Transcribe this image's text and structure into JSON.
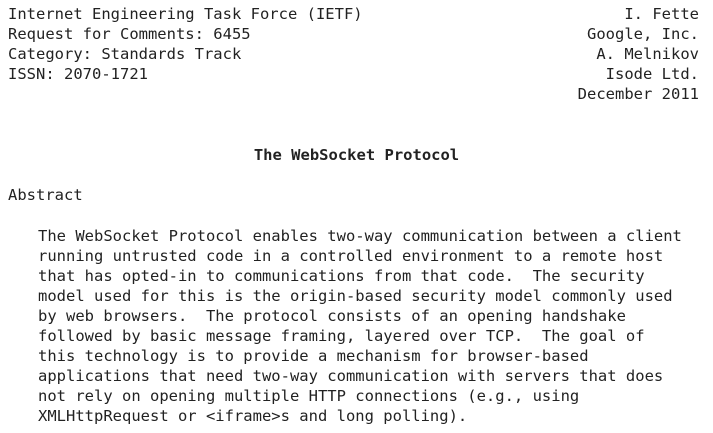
{
  "header": {
    "left": [
      "Internet Engineering Task Force (IETF)",
      "Request for Comments: 6455",
      "Category: Standards Track",
      "ISSN: 2070-1721"
    ],
    "right": [
      "I. Fette",
      "Google, Inc.",
      "A. Melnikov",
      "Isode Ltd.",
      "December 2011"
    ]
  },
  "title": "The WebSocket Protocol",
  "abstract": {
    "heading": "Abstract",
    "lines": [
      "The WebSocket Protocol enables two-way communication between a client",
      "running untrusted code in a controlled environment to a remote host",
      "that has opted-in to communications from that code.  The security",
      "model used for this is the origin-based security model commonly used",
      "by web browsers.  The protocol consists of an opening handshake",
      "followed by basic message framing, layered over TCP.  The goal of",
      "this technology is to provide a mechanism for browser-based",
      "applications that need two-way communication with servers that does",
      "not rely on opening multiple HTTP connections (e.g., using",
      "XMLHttpRequest or <iframe>s and long polling)."
    ]
  }
}
